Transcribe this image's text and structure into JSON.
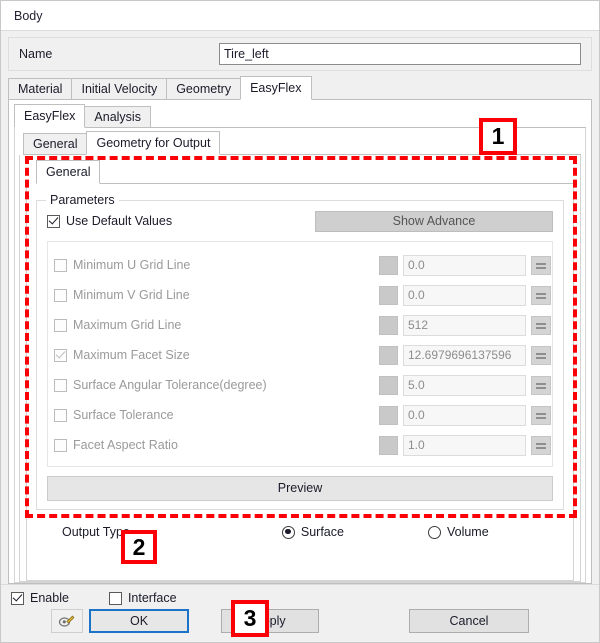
{
  "window": {
    "title": "Body"
  },
  "name_row": {
    "label": "Name",
    "value": "Tire_left",
    "placeholder": ""
  },
  "tabs_level1": [
    {
      "label": "Material",
      "active": false
    },
    {
      "label": "Initial Velocity",
      "active": false
    },
    {
      "label": "Geometry",
      "active": false
    },
    {
      "label": "EasyFlex",
      "active": true
    }
  ],
  "tabs_level2": [
    {
      "label": "EasyFlex",
      "active": true
    },
    {
      "label": "Analysis",
      "active": false
    }
  ],
  "tabs_level3": [
    {
      "label": "General",
      "active": false
    },
    {
      "label": "Geometry for Output",
      "active": true
    }
  ],
  "tabs_level4": [
    {
      "label": "General",
      "active": true
    }
  ],
  "parameters": {
    "legend": "Parameters",
    "use_default_values": {
      "label": "Use Default Values",
      "checked": true
    },
    "show_advance_label": "Show Advance",
    "rows": [
      {
        "label": "Minimum U Grid Line",
        "checked": false,
        "value": "0.0"
      },
      {
        "label": "Minimum V Grid Line",
        "checked": false,
        "value": "0.0"
      },
      {
        "label": "Maximum Grid Line",
        "checked": false,
        "value": "512"
      },
      {
        "label": "Maximum Facet Size",
        "checked": true,
        "value": "12.6979696137596"
      },
      {
        "label": "Surface Angular Tolerance(degree)",
        "checked": false,
        "value": "5.0"
      },
      {
        "label": "Surface Tolerance",
        "checked": false,
        "value": "0.0"
      },
      {
        "label": "Facet Aspect Ratio",
        "checked": false,
        "value": "1.0"
      }
    ],
    "preview_label": "Preview"
  },
  "output_type": {
    "label": "Output Type",
    "options": [
      {
        "label": "Surface",
        "selected": true
      },
      {
        "label": "Volume",
        "selected": false
      }
    ]
  },
  "footer": {
    "enable": {
      "label": "Enable",
      "checked": true
    },
    "interface": {
      "label": "Interface",
      "checked": false
    },
    "tool_icon": "wrench-icon",
    "ok_label": "OK",
    "apply_label": "Apply",
    "cancel_label": "Cancel"
  },
  "annotations": {
    "badge_1": "1",
    "badge_2": "2",
    "badge_3": "3",
    "highlight_color": "#fb0007"
  },
  "icons": {
    "equation": "equals-icon",
    "color_swatch": "color-swatch-icon"
  }
}
